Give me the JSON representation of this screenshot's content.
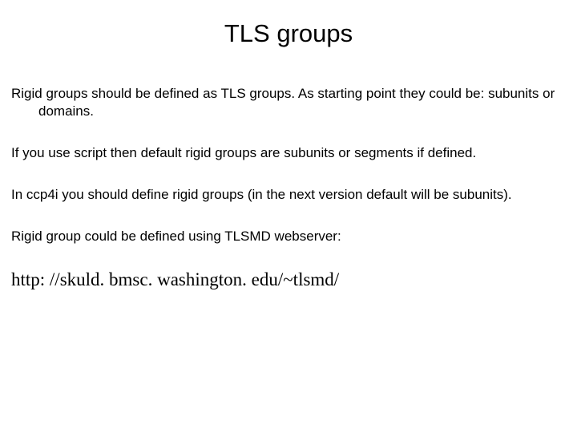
{
  "title": "TLS groups",
  "p1": "Rigid groups should be defined as TLS groups. As starting point they could be: subunits or domains.",
  "p2": "If you use script then default rigid groups are subunits or segments if defined.",
  "p3": "In ccp4i you should define rigid groups (in the next version default will be subunits).",
  "p4": "Rigid group could be defined using TLSMD webserver:",
  "url": "http: //skuld. bmsc. washington. edu/~tlsmd/"
}
